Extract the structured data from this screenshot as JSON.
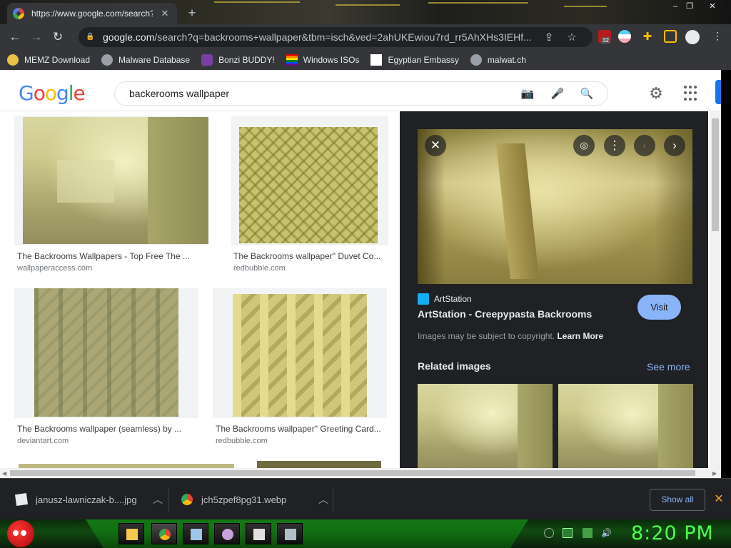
{
  "browser": {
    "tab_title": "https://www.google.com/search?",
    "address_host": "google.com",
    "address_rest": "/search?q=backrooms+wallpaper&tbm=isch&ved=2ahUKEwiou7rd_rr5AhXHs3IEHf...",
    "ext_badge": "32"
  },
  "bookmarks": [
    {
      "label": "MEMZ Download",
      "icon": "memz-icon"
    },
    {
      "label": "Malware Database",
      "icon": "globe-icon"
    },
    {
      "label": "Bonzi BUDDY!",
      "icon": "bonzi-icon"
    },
    {
      "label": "Windows ISOs",
      "icon": "windows-flag-icon"
    },
    {
      "label": "Egyptian Embassy",
      "icon": "wix-icon"
    },
    {
      "label": "malwat.ch",
      "icon": "globe-icon"
    }
  ],
  "google": {
    "logo": "Google",
    "query": "backerooms wallpaper"
  },
  "results": [
    {
      "title": "The Backrooms Wallpapers - Top Free The ...",
      "source": "wallpaperaccess.com"
    },
    {
      "title": "The Backrooms wallpaper\" Duvet Co...",
      "source": "redbubble.com"
    },
    {
      "title": "The Backrooms wallpaper (seamless) by ...",
      "source": "deviantart.com"
    },
    {
      "title": "The Backrooms wallpaper\" Greeting Card...",
      "source": "redbubble.com"
    }
  ],
  "preview": {
    "source_name": "ArtStation",
    "title": "ArtStation - Creepypasta Backrooms",
    "visit_label": "Visit",
    "copyright_text": "Images may be subject to copyright.",
    "learn_more": "Learn More",
    "related_label": "Related images",
    "see_more": "See more"
  },
  "downloads": [
    {
      "name": "janusz-lawniczak-b....jpg"
    },
    {
      "name": "jch5zpef8pg31.webp"
    }
  ],
  "downloads_bar": {
    "show_all": "Show all"
  },
  "taskbar": {
    "clock": "8:20 PM"
  }
}
